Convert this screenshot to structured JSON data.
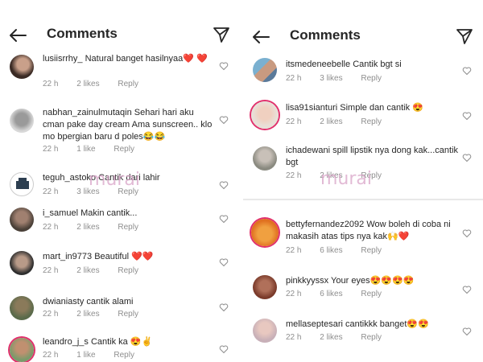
{
  "left": {
    "title": "Comments",
    "comments": [
      {
        "user": "lusiisrrhy_",
        "text": "Natural banget hasilnyaa❤️ ❤️",
        "time": "22 h",
        "likes": "2 likes",
        "reply": "Reply"
      },
      {
        "user": "nabhan_zainulmutaqin",
        "text": "Sehari hari aku cman pake day cream Ama sunscreen.. klo mo bpergian baru d poles😂😂",
        "time": "22 h",
        "likes": "1 like",
        "reply": "Reply"
      },
      {
        "user": "teguh_astoko",
        "text": "Cantik dari lahir",
        "time": "22 h",
        "likes": "3 likes",
        "reply": "Reply"
      },
      {
        "user": "i_samuel",
        "text": "Makin cantik...",
        "time": "22 h",
        "likes": "2 likes",
        "reply": "Reply"
      },
      {
        "user": "mart_in9773",
        "text": "Beautiful ❤️❤️",
        "time": "22 h",
        "likes": "2 likes",
        "reply": "Reply"
      },
      {
        "user": "dwianiasty",
        "text": "cantik alami",
        "time": "22 h",
        "likes": "2 likes",
        "reply": "Reply"
      },
      {
        "user": "leandro_j_s",
        "text": "Cantik ka 😍✌️",
        "time": "22 h",
        "likes": "1 like",
        "reply": "Reply"
      }
    ],
    "watermark": "murai"
  },
  "right": {
    "title": "Comments",
    "comments": [
      {
        "user": "itsmedeneebelle",
        "text": "Cantik bgt si",
        "time": "22 h",
        "likes": "3 likes",
        "reply": "Reply"
      },
      {
        "user": "lisa91sianturi",
        "text": "Simple dan cantik 😍",
        "time": "22 h",
        "likes": "2 likes",
        "reply": "Reply"
      },
      {
        "user": "ichadewani",
        "text": "spill lipstik nya dong kak...cantik bgt",
        "time": "22 h",
        "likes": "2 likes",
        "reply": "Reply"
      },
      {
        "user": "bettyfernandez2092",
        "text": "Wow boleh di coba ni makasih atas tips nya kak🙌❤️",
        "time": "22 h",
        "likes": "6 likes",
        "reply": "Reply"
      },
      {
        "user": "pinkkyyssx",
        "text": "Your eyes😍😍😍😍",
        "time": "22 h",
        "likes": "6 likes",
        "reply": "Reply"
      },
      {
        "user": "mellaseptesari",
        "text": "cantikkk banget😍😍",
        "time": "22 h",
        "likes": "2 likes",
        "reply": "Reply"
      }
    ],
    "watermark": "murai"
  },
  "colors": {
    "accent_ring": "#e1306c",
    "meta": "#8e8e8e",
    "text": "#262626"
  },
  "icons": {
    "back": "arrow-left-icon",
    "send": "paper-plane-icon",
    "like": "heart-outline-icon"
  }
}
